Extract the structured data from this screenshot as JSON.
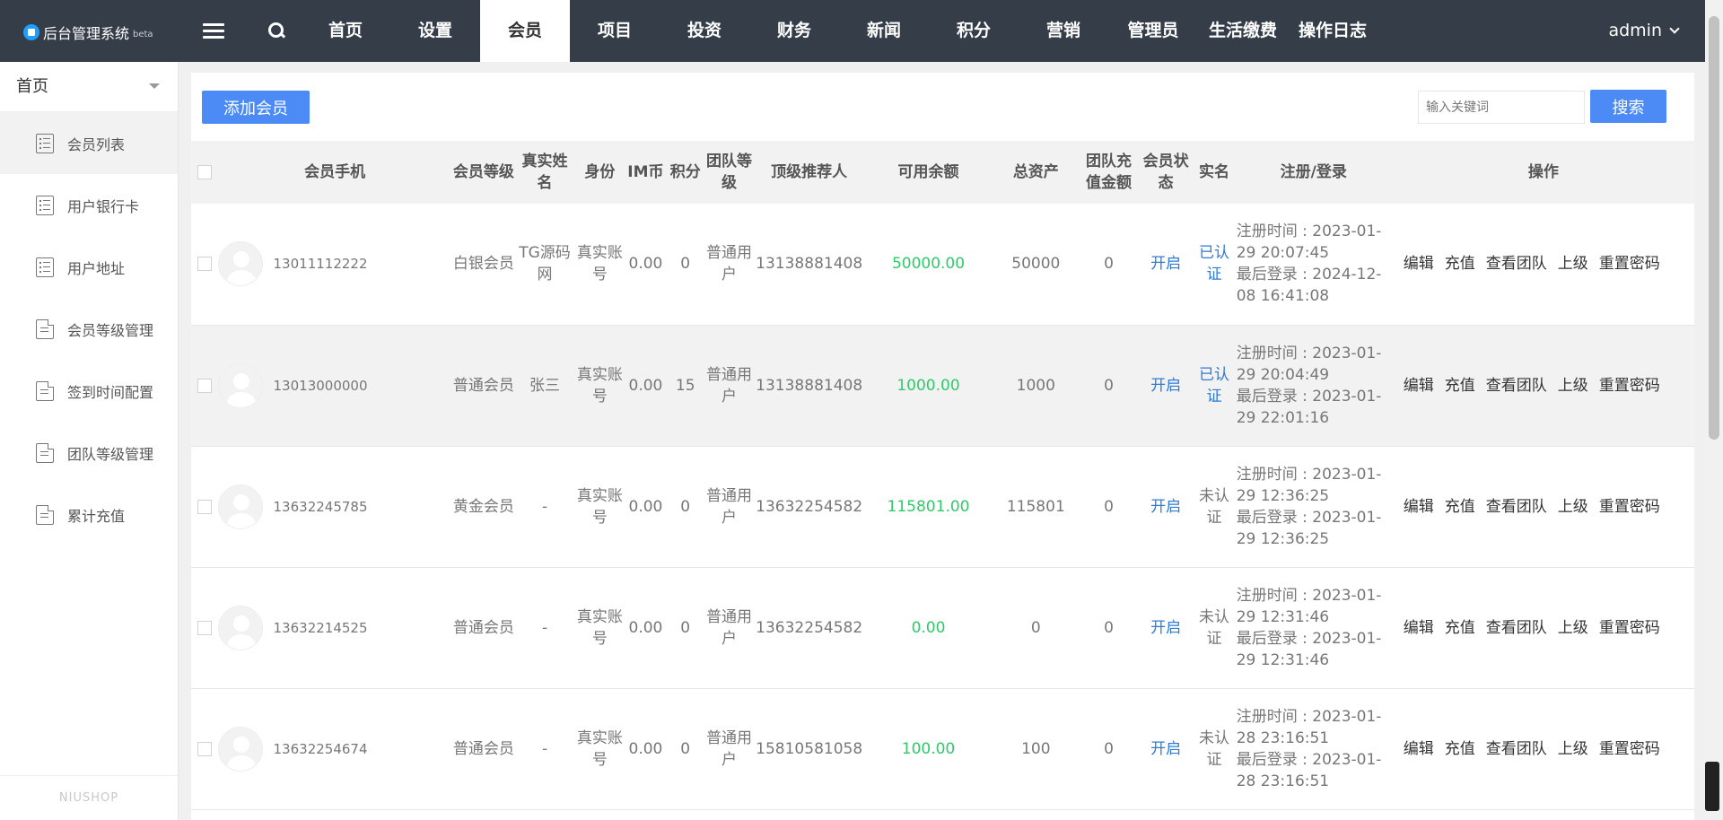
{
  "app": {
    "title": "后台管理系统",
    "badge": "beta"
  },
  "nav": [
    "首页",
    "设置",
    "会员",
    "项目",
    "投资",
    "财务",
    "新闻",
    "积分",
    "营销",
    "管理员",
    "生活缴费",
    "操作日志"
  ],
  "nav_active": 2,
  "user": {
    "name": "admin"
  },
  "sidebar": {
    "heading": "首页",
    "items": [
      {
        "label": "会员列表",
        "icon": "list-icon"
      },
      {
        "label": "用户银行卡",
        "icon": "list-icon"
      },
      {
        "label": "用户地址",
        "icon": "list-icon"
      },
      {
        "label": "会员等级管理",
        "icon": "document-icon"
      },
      {
        "label": "签到时间配置",
        "icon": "document-icon"
      },
      {
        "label": "团队等级管理",
        "icon": "document-icon"
      },
      {
        "label": "累计充值",
        "icon": "document-icon"
      }
    ],
    "active": 0,
    "footer": "NIUSHOP"
  },
  "toolbar": {
    "add_label": "添加会员",
    "search_placeholder": "输入关键词",
    "search_label": "搜索"
  },
  "table": {
    "headers": [
      "会员手机",
      "会员等级",
      "真实姓名",
      "身份",
      "IM币",
      "积分",
      "团队等级",
      "顶级推荐人",
      "可用余额",
      "总资产",
      "团队充值金额",
      "会员状态",
      "实名",
      "注册/登录",
      "操作"
    ],
    "operations": [
      "编辑",
      "充值",
      "查看团队",
      "上级",
      "重置密码"
    ],
    "rows": [
      {
        "phone": "13011112222",
        "level": "白银会员",
        "name": "TG源码网",
        "identity": "真实账号",
        "im": "0.00",
        "points": "0",
        "team_level": "普通用户",
        "referrer": "13138881408",
        "balance": "50000.00",
        "total": "50000",
        "team_recharge": "0",
        "status": "开启",
        "verified": "已认证",
        "verified_ok": true,
        "reg": "注册时间 : 2023-01-29 20:07:45",
        "login": "最后登录 : 2024-12-08 16:41:08"
      },
      {
        "phone": "13013000000",
        "level": "普通会员",
        "name": "张三",
        "identity": "真实账号",
        "im": "0.00",
        "points": "15",
        "team_level": "普通用户",
        "referrer": "13138881408",
        "balance": "1000.00",
        "total": "1000",
        "team_recharge": "0",
        "status": "开启",
        "verified": "已认证",
        "verified_ok": true,
        "reg": "注册时间 : 2023-01-29 20:04:49",
        "login": "最后登录 : 2023-01-29 22:01:16"
      },
      {
        "phone": "13632245785",
        "level": "黄金会员",
        "name": "-",
        "identity": "真实账号",
        "im": "0.00",
        "points": "0",
        "team_level": "普通用户",
        "referrer": "13632254582",
        "balance": "115801.00",
        "total": "115801",
        "team_recharge": "0",
        "status": "开启",
        "verified": "未认证",
        "verified_ok": false,
        "reg": "注册时间 : 2023-01-29 12:36:25",
        "login": "最后登录 : 2023-01-29 12:36:25"
      },
      {
        "phone": "13632214525",
        "level": "普通会员",
        "name": "-",
        "identity": "真实账号",
        "im": "0.00",
        "points": "0",
        "team_level": "普通用户",
        "referrer": "13632254582",
        "balance": "0.00",
        "total": "0",
        "team_recharge": "0",
        "status": "开启",
        "verified": "未认证",
        "verified_ok": false,
        "reg": "注册时间 : 2023-01-29 12:31:46",
        "login": "最后登录 : 2023-01-29 12:31:46"
      },
      {
        "phone": "13632254674",
        "level": "普通会员",
        "name": "-",
        "identity": "真实账号",
        "im": "0.00",
        "points": "0",
        "team_level": "普通用户",
        "referrer": "15810581058",
        "balance": "100.00",
        "total": "100",
        "team_recharge": "0",
        "status": "开启",
        "verified": "未认证",
        "verified_ok": false,
        "reg": "注册时间 : 2023-01-28 23:16:51",
        "login": "最后登录 : 2023-01-28 23:16:51"
      }
    ]
  },
  "colors": {
    "topbar": "#353d49",
    "primary": "#4c8bf5",
    "balance_green": "#2fca6b",
    "link_blue": "#2f7bd6"
  }
}
